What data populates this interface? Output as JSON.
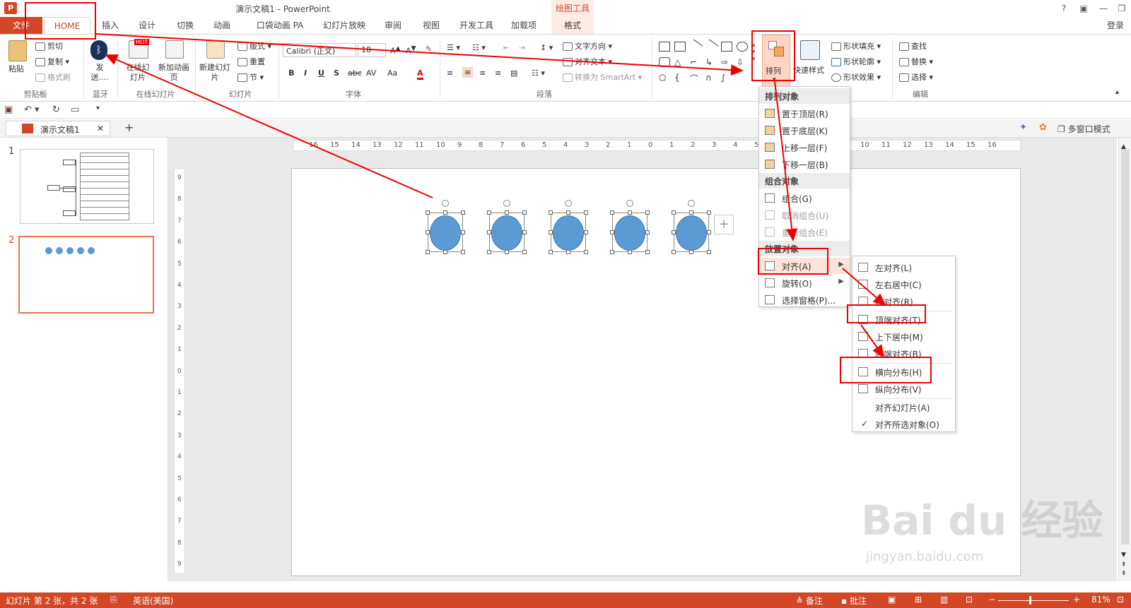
{
  "window": {
    "title": "演示文稿1 - PowerPoint",
    "logo": "P",
    "drawing_tools": "绘图工具",
    "login": "登录"
  },
  "tabs": [
    "文件",
    "HOME",
    "插入",
    "设计",
    "切换",
    "动画",
    "口袋动画 PA",
    "幻灯片放映",
    "审阅",
    "视图",
    "开发工具",
    "加载项",
    "格式"
  ],
  "ribbon": {
    "clipboard": {
      "paste": "粘贴",
      "cut": "剪切",
      "copy": "复制",
      "format_painter": "格式刷",
      "label": "剪贴板"
    },
    "bluetooth": {
      "send": "发送....",
      "label": "蓝牙"
    },
    "online": {
      "online_slide": "在线幻灯片",
      "new_page": "新加动画页",
      "label": "在线幻灯片",
      "hot": "HOT"
    },
    "slides": {
      "new_slide": "新建幻灯片",
      "layout": "版式",
      "reset": "重置",
      "section": "节",
      "label": "幻灯片"
    },
    "font": {
      "name": "Calibri (正文)",
      "size": "18",
      "label": "字体",
      "bold": "B",
      "italic": "I",
      "underline": "U",
      "shadow": "S",
      "strike": "abc",
      "spacing": "AV",
      "case": "Aa",
      "color": "A"
    },
    "paragraph": {
      "text_direction": "文字方向",
      "align_text": "对齐文本",
      "smartart": "转换为 SmartArt",
      "label": "段落"
    },
    "drawing": {
      "arrange": "排列",
      "quick_styles": "快速样式",
      "shape_fill": "形状填充",
      "shape_outline": "形状轮廓",
      "shape_effects": "形状效果"
    },
    "editing": {
      "find": "查找",
      "replace": "替换",
      "select": "选择",
      "label": "编辑"
    }
  },
  "qat": {
    "save": "save",
    "undo": "undo",
    "redo": "redo",
    "present": "present"
  },
  "docbar": {
    "tab_title": "演示文稿1",
    "close": "✕",
    "add": "+",
    "multi_window": "多窗口模式"
  },
  "slides": [
    {
      "num": "1"
    },
    {
      "num": "2"
    }
  ],
  "ruler": {
    "h_ticks": [
      "16",
      "15",
      "14",
      "13",
      "12",
      "11",
      "10",
      "9",
      "8",
      "7",
      "6",
      "5",
      "4",
      "3",
      "2",
      "1",
      "0",
      "1",
      "2",
      "3",
      "4",
      "5",
      "6",
      "7",
      "8",
      "9",
      "10",
      "11",
      "12",
      "13",
      "14",
      "15",
      "16"
    ],
    "v_ticks": [
      "9",
      "8",
      "7",
      "6",
      "5",
      "4",
      "3",
      "2",
      "1",
      "0",
      "1",
      "2",
      "3",
      "4",
      "5",
      "6",
      "7",
      "8",
      "9"
    ]
  },
  "arrange_menu": {
    "header_order": "排列对象",
    "bring_front": "置于顶层(R)",
    "send_back": "置于底层(K)",
    "bring_forward": "上移一层(F)",
    "send_backward": "下移一层(B)",
    "header_group": "组合对象",
    "group": "组合(G)",
    "ungroup": "取消组合(U)",
    "regroup": "重新组合(E)",
    "header_position": "放置对象",
    "align": "对齐(A)",
    "rotate": "旋转(O)",
    "selection_pane": "选择窗格(P)..."
  },
  "align_menu": {
    "left": "左对齐(L)",
    "center": "左右居中(C)",
    "right": "右对齐(R)",
    "top": "顶端对齐(T)",
    "middle": "上下居中(M)",
    "bottom": "底端对齐(B)",
    "dist_h": "横向分布(H)",
    "dist_v": "纵向分布(V)",
    "to_slide": "对齐幻灯片(A)",
    "to_selected": "对齐所选对象(O)",
    "check": "✓"
  },
  "status": {
    "slide_info": "幻灯片 第 2 张，共 2 张",
    "language": "英语(美国)",
    "notes": "备注",
    "comments": "批注",
    "zoom": "81%",
    "minus": "−",
    "plus": "+"
  },
  "watermark": {
    "brand": "Bai du 经验",
    "sub": "jingyan.baidu.com"
  },
  "colors": {
    "accent": "#d24726",
    "shape_fill": "#5b9bd5",
    "annotation": "#ee0000"
  }
}
